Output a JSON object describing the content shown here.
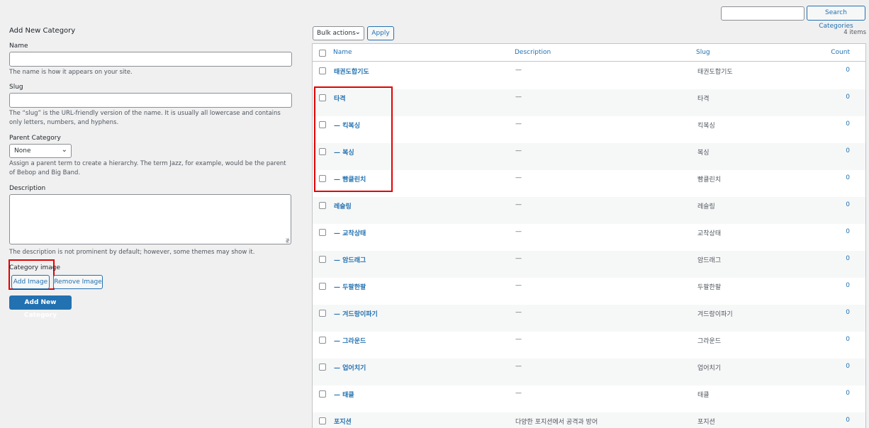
{
  "form": {
    "title": "Add New Category",
    "name_label": "Name",
    "name_value": "",
    "name_help": "The name is how it appears on your site.",
    "slug_label": "Slug",
    "slug_value": "",
    "slug_help": "The “slug” is the URL-friendly version of the name. It is usually all lowercase and contains only letters, numbers, and hyphens.",
    "parent_label": "Parent Category",
    "parent_selected": "None",
    "parent_help": "Assign a parent term to create a hierarchy. The term Jazz, for example, would be the parent of Bebop and Big Band.",
    "description_label": "Description",
    "description_value": "",
    "description_help": "The description is not prominent by default; however, some themes may show it.",
    "image_label": "Category image",
    "add_image": "Add Image",
    "remove_image": "Remove Image",
    "submit": "Add New Category"
  },
  "toolbar": {
    "search_value": "",
    "search_button": "Search Categories",
    "bulk_actions": "Bulk actions",
    "apply": "Apply",
    "items_count": "4 items"
  },
  "table": {
    "columns": {
      "name": "Name",
      "description": "Description",
      "slug": "Slug",
      "count": "Count"
    },
    "rows": [
      {
        "name": "태권도합기도",
        "description": "—",
        "slug": "태권도합기도",
        "count": "0"
      },
      {
        "name": "타격",
        "description": "—",
        "slug": "타격",
        "count": "0"
      },
      {
        "name": "— 킥복싱",
        "description": "—",
        "slug": "킥복싱",
        "count": "0"
      },
      {
        "name": "— 복싱",
        "description": "—",
        "slug": "복싱",
        "count": "0"
      },
      {
        "name": "— 빰클린치",
        "description": "—",
        "slug": "빰클린치",
        "count": "0"
      },
      {
        "name": "레슬링",
        "description": "—",
        "slug": "레슬링",
        "count": "0"
      },
      {
        "name": "— 교착상태",
        "description": "—",
        "slug": "교착상태",
        "count": "0"
      },
      {
        "name": "— 암드래그",
        "description": "—",
        "slug": "암드래그",
        "count": "0"
      },
      {
        "name": "— 두팔한팔",
        "description": "—",
        "slug": "두팔한팔",
        "count": "0"
      },
      {
        "name": "— 겨드랑이파기",
        "description": "—",
        "slug": "겨드랑이파기",
        "count": "0"
      },
      {
        "name": "— 그라운드",
        "description": "—",
        "slug": "그라운드",
        "count": "0"
      },
      {
        "name": "— 업어치기",
        "description": "—",
        "slug": "업어치기",
        "count": "0"
      },
      {
        "name": "— 태클",
        "description": "—",
        "slug": "태클",
        "count": "0"
      },
      {
        "name": "포지션",
        "description": "다양한 포지션에서 공격과 방어",
        "slug": "포지션",
        "count": "0"
      }
    ]
  }
}
